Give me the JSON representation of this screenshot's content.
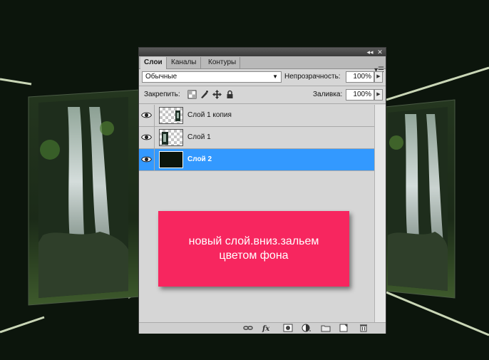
{
  "panel": {
    "tabs": [
      {
        "label": "Слои",
        "active": true
      },
      {
        "label": "Каналы",
        "active": false
      },
      {
        "label": "Контуры",
        "active": false
      }
    ],
    "titlebar": {
      "collapse_glyph": "◂◂",
      "close_glyph": "✕"
    },
    "blend_mode": "Обычные",
    "opacity_label": "Непрозрачность:",
    "opacity_value": "100%",
    "lock_label": "Закрепить:",
    "fill_label": "Заливка:",
    "fill_value": "100%",
    "layers": [
      {
        "name": "Слой 1 копия",
        "visible": true,
        "selected": false,
        "thumb": "transparent-with-object"
      },
      {
        "name": "Слой 1",
        "visible": true,
        "selected": false,
        "thumb": "transparent-with-object"
      },
      {
        "name": "Слой 2",
        "visible": true,
        "selected": true,
        "thumb": "solid-dark-fill"
      }
    ],
    "bottom_icons": [
      "link-layers-icon",
      "fx-icon",
      "add-mask-icon",
      "adjustment-layer-icon",
      "new-group-icon",
      "new-layer-icon",
      "trash-icon"
    ],
    "accent_color": "#3399ff"
  },
  "callout": {
    "line1": "новый слой.вниз.зальем",
    "line2": "цветом фона",
    "color": "#f7265f"
  },
  "background": {
    "color": "#0c150c",
    "scene": "waterfall-panels"
  }
}
